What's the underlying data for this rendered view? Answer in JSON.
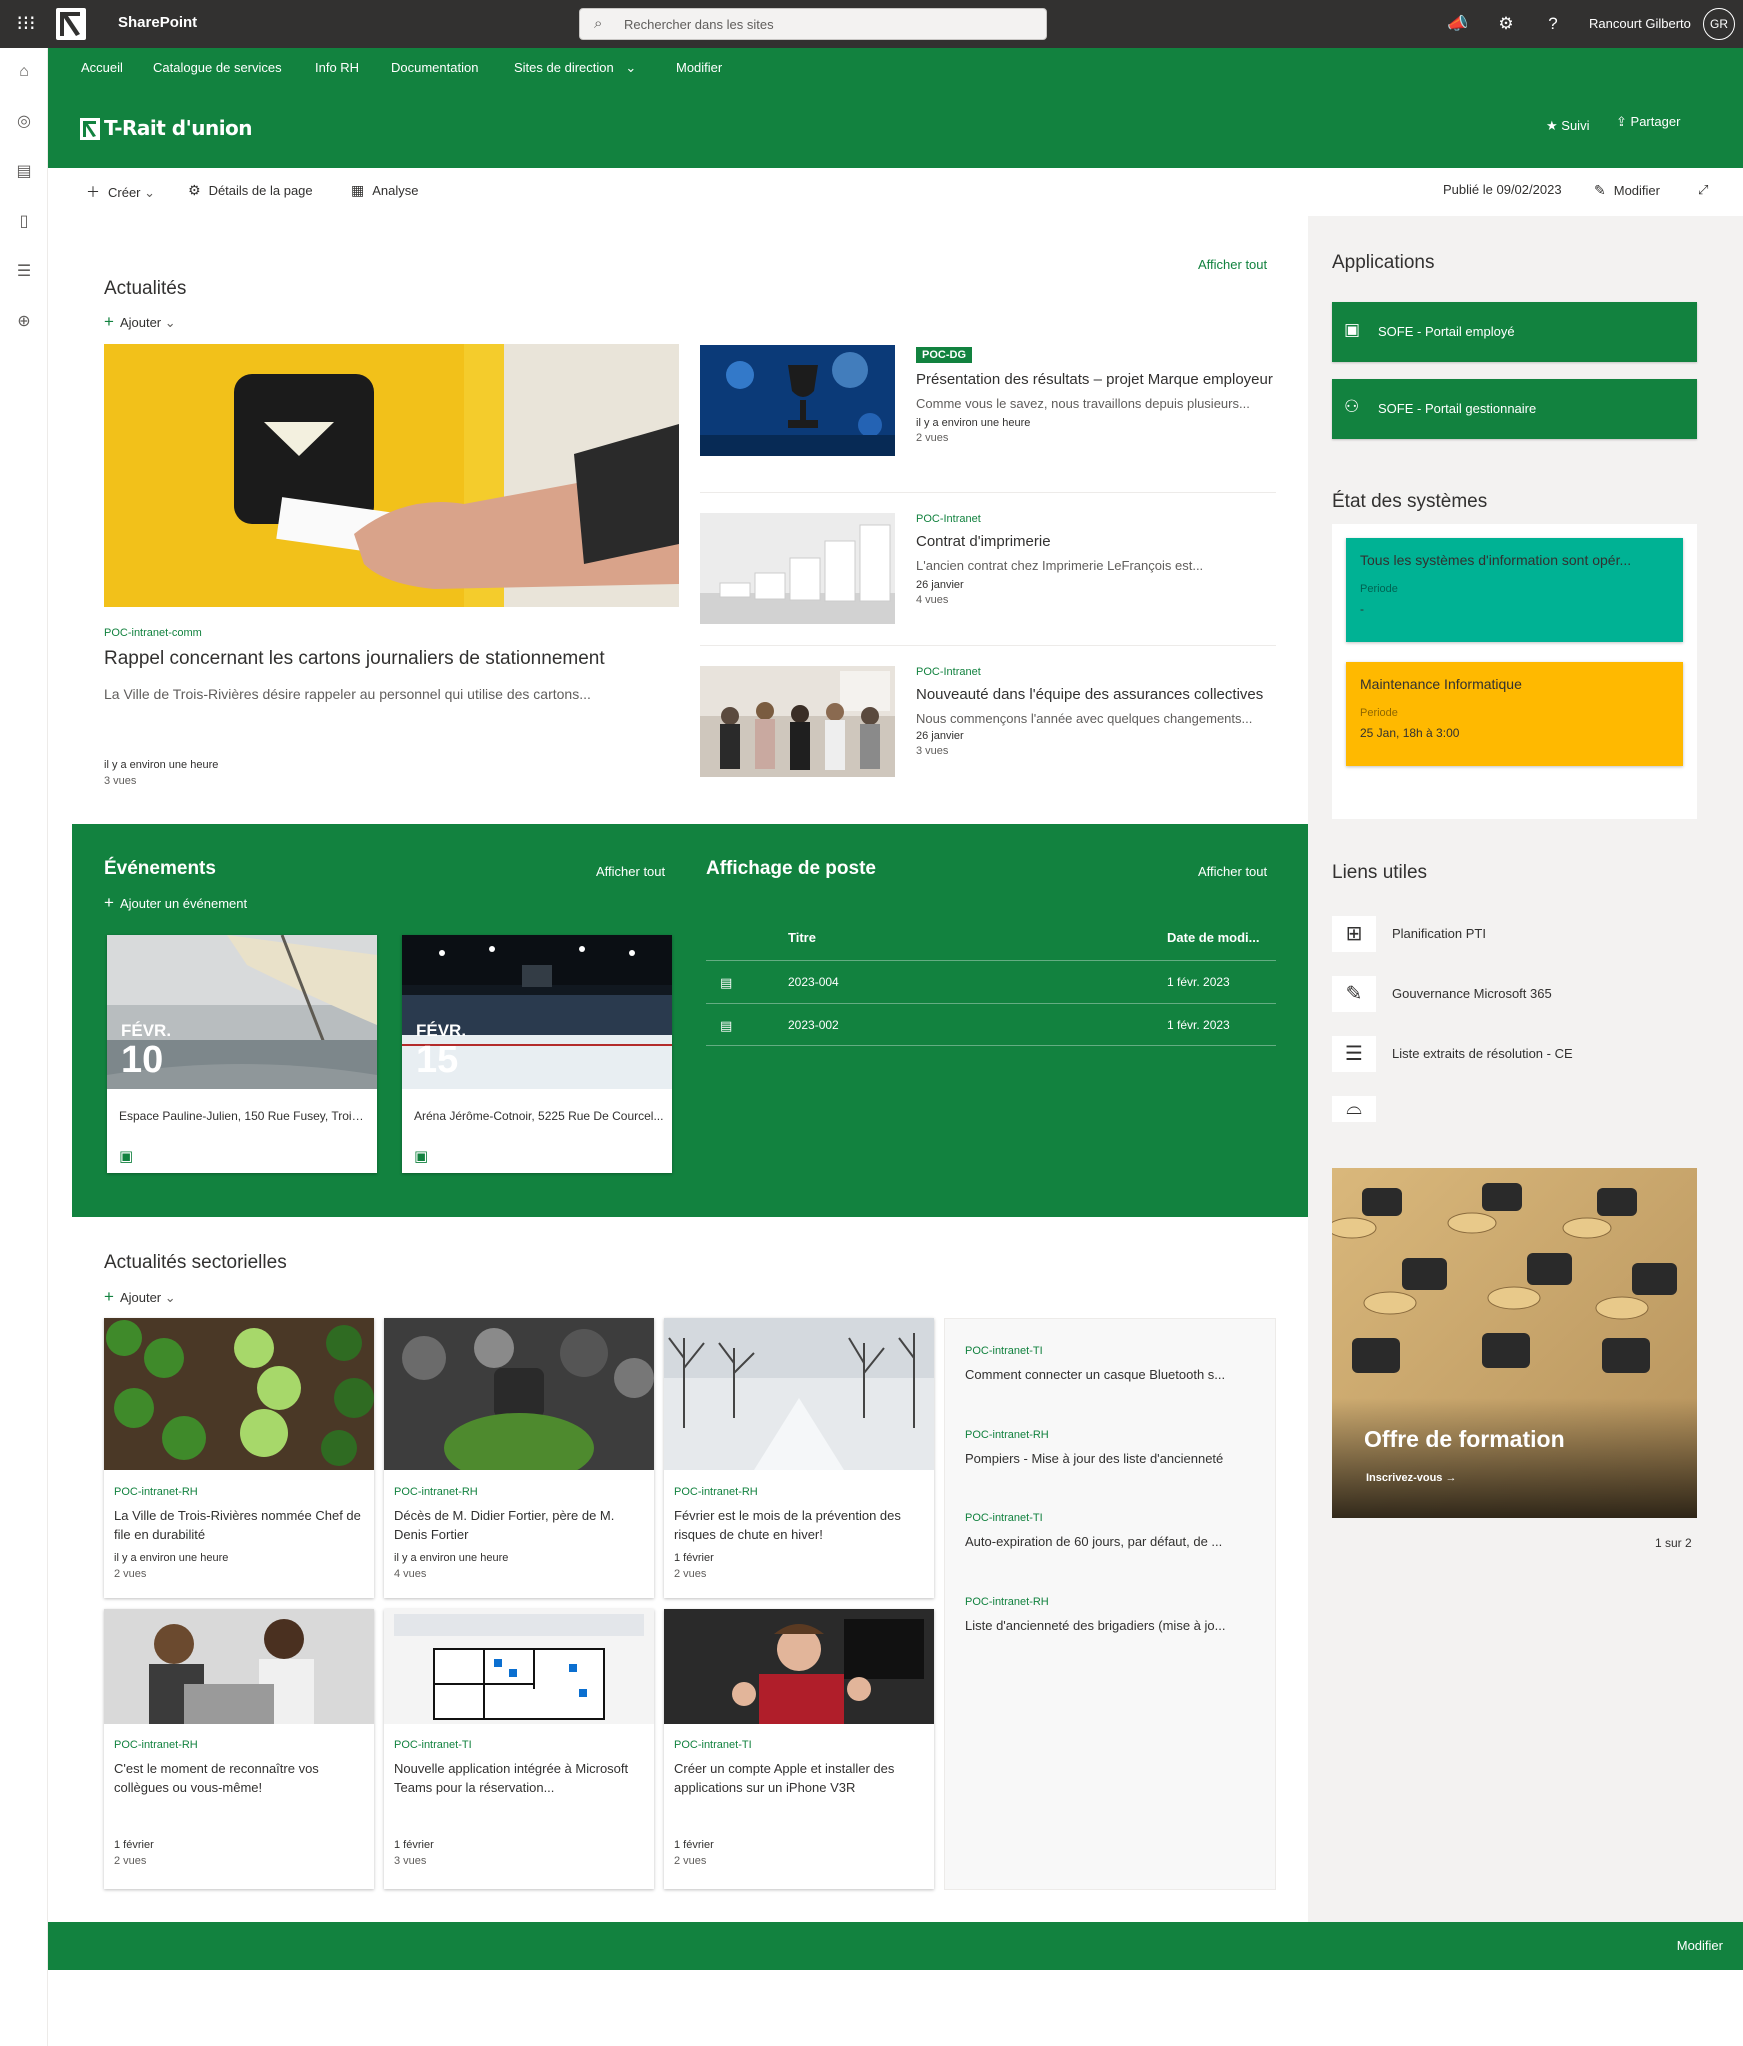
{
  "suitebar": {
    "app_name": "SharePoint",
    "search_placeholder": "Rechercher dans les sites",
    "user_name": "Rancourt Gilberto",
    "user_initials": "GR"
  },
  "hubnav": {
    "items": [
      "Accueil",
      "Catalogue de services",
      "Info RH",
      "Documentation",
      "Sites de direction",
      "Modifier"
    ]
  },
  "site": {
    "title": "T-Rait d'union",
    "follow_label": "Suivi",
    "share_label": "Partager"
  },
  "cmdbar": {
    "create": "Créer",
    "details": "Détails de la page",
    "analytics": "Analyse",
    "published": "Publié le 09/02/2023",
    "edit": "Modifier"
  },
  "news": {
    "title": "Actualités",
    "see_all": "Afficher tout",
    "add": "Ajouter",
    "hero": {
      "tag": "POC-intranet-comm",
      "title": "Rappel concernant les cartons journaliers de stationnement",
      "desc": "La Ville de Trois-Rivières désire rappeler au personnel qui utilise des cartons...",
      "meta": "il y a environ une heure",
      "views": "3 vues"
    },
    "items": [
      {
        "tag": "POC-DG",
        "title": "Présentation des résultats – projet Marque employeur",
        "desc": "Comme vous le savez, nous travaillons depuis plusieurs...",
        "meta": "il y a environ une heure",
        "views": "2 vues"
      },
      {
        "tag": "POC-Intranet",
        "title": "Contrat d'imprimerie",
        "desc": "L'ancien contrat chez Imprimerie LeFrançois est...",
        "meta": "26 janvier",
        "views": "4 vues"
      },
      {
        "tag": "POC-Intranet",
        "title": "Nouveauté dans l'équipe des assurances collectives",
        "desc": "Nous commençons l'année avec quelques changements...",
        "meta": "26 janvier",
        "views": "3 vues"
      }
    ]
  },
  "events": {
    "title": "Événements",
    "see_all": "Afficher tout",
    "add": "Ajouter un événement",
    "items": [
      {
        "month": "FÉVR.",
        "day": "10",
        "location": "Espace Pauline-Julien, 150 Rue Fusey, Trois-..."
      },
      {
        "month": "FÉVR.",
        "day": "15",
        "location": "Aréna Jérôme-Cotnoir, 5225 Rue De Courcel..."
      }
    ]
  },
  "jobs": {
    "title": "Affichage de poste",
    "see_all": "Afficher tout",
    "col_title": "Titre",
    "col_date": "Date de modi...",
    "rows": [
      {
        "title": "2023-004",
        "date": "1 févr. 2023"
      },
      {
        "title": "2023-002",
        "date": "1 févr. 2023"
      }
    ]
  },
  "apps": {
    "title": "Applications",
    "items": [
      "SOFE - Portail employé",
      "SOFE - Portail gestionnaire"
    ]
  },
  "status": {
    "title": "État des systèmes",
    "cards": [
      {
        "text": "Tous les systèmes d'information sont opér...",
        "period_label": "Periode",
        "period": "-",
        "color": "#00b294"
      },
      {
        "text": "Maintenance Informatique",
        "period_label": "Periode",
        "period": "25 Jan, 18h à 3:00",
        "color": "#ffb900"
      }
    ]
  },
  "links": {
    "title": "Liens utiles",
    "items": [
      "Planification PTI",
      "Gouvernance Microsoft 365",
      "Liste extraits de résolution - CE"
    ]
  },
  "promo": {
    "title": "Offre de formation",
    "cta": "Inscrivez-vous →",
    "pager": "1 sur 2"
  },
  "sector": {
    "title": "Actualités sectorielles",
    "add": "Ajouter",
    "cards": [
      {
        "tag": "POC-intranet-RH",
        "title": "La Ville de Trois-Rivières nommée Chef de file en durabilité",
        "meta": "il y a environ une heure",
        "views": "2 vues"
      },
      {
        "tag": "POC-intranet-RH",
        "title": "Décès de M. Didier Fortier, père de M. Denis Fortier",
        "meta": "il y a environ une heure",
        "views": "4 vues"
      },
      {
        "tag": "POC-intranet-RH",
        "title": "Février est le mois de la prévention des risques de chute en hiver!",
        "meta": "1 février",
        "views": "2 vues"
      },
      {
        "tag": "POC-intranet-RH",
        "title": "C'est le moment de reconnaître vos collègues ou vous-même!",
        "meta": "1 février",
        "views": "2 vues"
      },
      {
        "tag": "POC-intranet-TI",
        "title": "Nouvelle application intégrée à Microsoft Teams pour la réservation...",
        "meta": "1 février",
        "views": "3 vues"
      },
      {
        "tag": "POC-intranet-TI",
        "title": "Créer un compte Apple et installer des applications sur un iPhone V3R",
        "meta": "1 février",
        "views": "2 vues"
      }
    ],
    "list": [
      {
        "tag": "POC-intranet-TI",
        "title": "Comment connecter un casque Bluetooth s..."
      },
      {
        "tag": "POC-intranet-RH",
        "title": "Pompiers - Mise à jour des liste d'ancienneté"
      },
      {
        "tag": "POC-intranet-TI",
        "title": "Auto-expiration de 60 jours, par défaut, de ..."
      },
      {
        "tag": "POC-intranet-RH",
        "title": "Liste d'ancienneté des brigadiers (mise à jo..."
      }
    ]
  },
  "footer": {
    "edit": "Modifier"
  }
}
